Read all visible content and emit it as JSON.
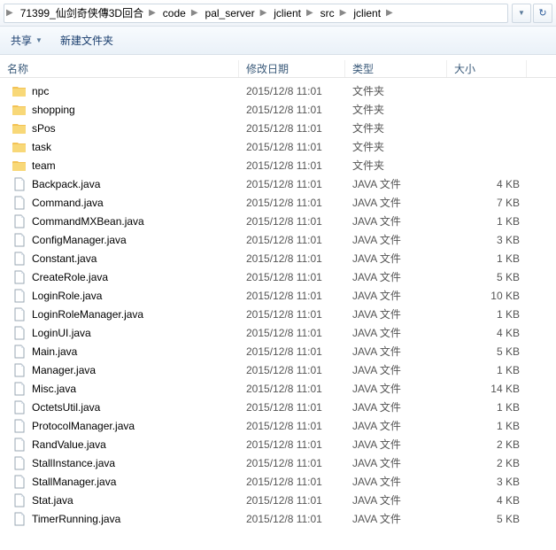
{
  "breadcrumb": {
    "items": [
      {
        "label": "71399_仙剑奇侠傳3D回合"
      },
      {
        "label": "code"
      },
      {
        "label": "pal_server"
      },
      {
        "label": "jclient"
      },
      {
        "label": "src"
      },
      {
        "label": "jclient"
      }
    ]
  },
  "toolbar": {
    "share": "共享",
    "newfolder": "新建文件夹"
  },
  "columns": {
    "name": "名称",
    "date": "修改日期",
    "type": "类型",
    "size": "大小"
  },
  "typeLabels": {
    "folder": "文件夹",
    "java": "JAVA 文件"
  },
  "files": [
    {
      "name": "npc",
      "date": "2015/12/8 11:01",
      "kind": "folder",
      "size": ""
    },
    {
      "name": "shopping",
      "date": "2015/12/8 11:01",
      "kind": "folder",
      "size": ""
    },
    {
      "name": "sPos",
      "date": "2015/12/8 11:01",
      "kind": "folder",
      "size": ""
    },
    {
      "name": "task",
      "date": "2015/12/8 11:01",
      "kind": "folder",
      "size": ""
    },
    {
      "name": "team",
      "date": "2015/12/8 11:01",
      "kind": "folder",
      "size": ""
    },
    {
      "name": "Backpack.java",
      "date": "2015/12/8 11:01",
      "kind": "java",
      "size": "4 KB"
    },
    {
      "name": "Command.java",
      "date": "2015/12/8 11:01",
      "kind": "java",
      "size": "7 KB"
    },
    {
      "name": "CommandMXBean.java",
      "date": "2015/12/8 11:01",
      "kind": "java",
      "size": "1 KB"
    },
    {
      "name": "ConfigManager.java",
      "date": "2015/12/8 11:01",
      "kind": "java",
      "size": "3 KB"
    },
    {
      "name": "Constant.java",
      "date": "2015/12/8 11:01",
      "kind": "java",
      "size": "1 KB"
    },
    {
      "name": "CreateRole.java",
      "date": "2015/12/8 11:01",
      "kind": "java",
      "size": "5 KB"
    },
    {
      "name": "LoginRole.java",
      "date": "2015/12/8 11:01",
      "kind": "java",
      "size": "10 KB"
    },
    {
      "name": "LoginRoleManager.java",
      "date": "2015/12/8 11:01",
      "kind": "java",
      "size": "1 KB"
    },
    {
      "name": "LoginUI.java",
      "date": "2015/12/8 11:01",
      "kind": "java",
      "size": "4 KB"
    },
    {
      "name": "Main.java",
      "date": "2015/12/8 11:01",
      "kind": "java",
      "size": "5 KB"
    },
    {
      "name": "Manager.java",
      "date": "2015/12/8 11:01",
      "kind": "java",
      "size": "1 KB"
    },
    {
      "name": "Misc.java",
      "date": "2015/12/8 11:01",
      "kind": "java",
      "size": "14 KB"
    },
    {
      "name": "OctetsUtil.java",
      "date": "2015/12/8 11:01",
      "kind": "java",
      "size": "1 KB"
    },
    {
      "name": "ProtocolManager.java",
      "date": "2015/12/8 11:01",
      "kind": "java",
      "size": "1 KB"
    },
    {
      "name": "RandValue.java",
      "date": "2015/12/8 11:01",
      "kind": "java",
      "size": "2 KB"
    },
    {
      "name": "StallInstance.java",
      "date": "2015/12/8 11:01",
      "kind": "java",
      "size": "2 KB"
    },
    {
      "name": "StallManager.java",
      "date": "2015/12/8 11:01",
      "kind": "java",
      "size": "3 KB"
    },
    {
      "name": "Stat.java",
      "date": "2015/12/8 11:01",
      "kind": "java",
      "size": "4 KB"
    },
    {
      "name": "TimerRunning.java",
      "date": "2015/12/8 11:01",
      "kind": "java",
      "size": "5 KB"
    }
  ]
}
